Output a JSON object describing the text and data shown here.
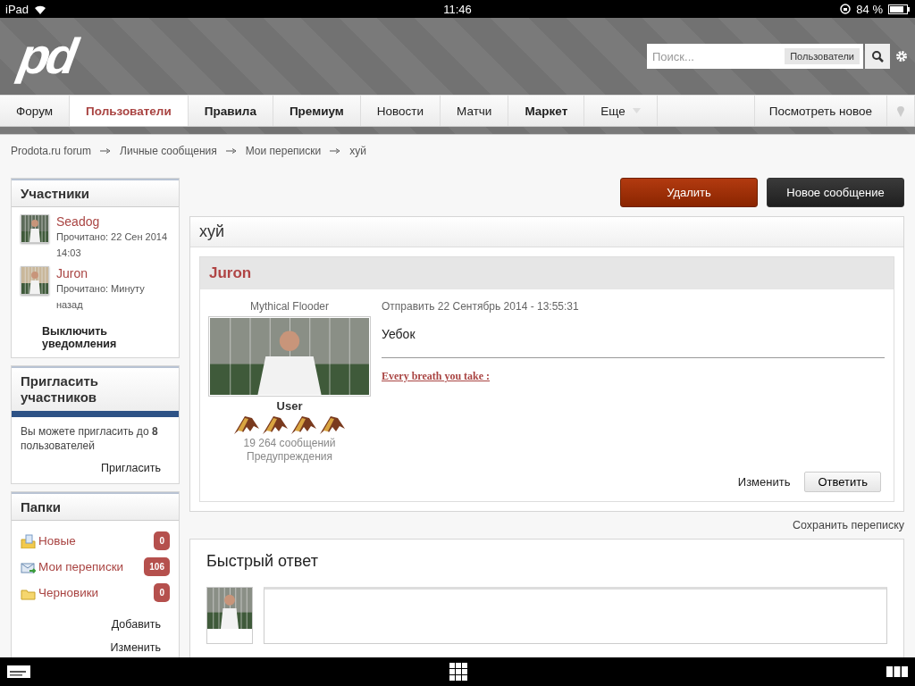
{
  "status_bar": {
    "device": "iPad",
    "time": "11:46",
    "battery": "84 %"
  },
  "header": {
    "logo": "pd",
    "search": {
      "placeholder": "Поиск...",
      "scope": "Пользователи"
    }
  },
  "nav": {
    "tabs": [
      {
        "label": "Форум",
        "selected": false,
        "kind": "plain"
      },
      {
        "label": "Пользователи",
        "selected": true,
        "kind": "plain"
      },
      {
        "label": "Правила",
        "selected": false,
        "kind": "strong"
      },
      {
        "label": "Премиум",
        "selected": false,
        "kind": "strong"
      },
      {
        "label": "Новости",
        "selected": false,
        "kind": "plain"
      },
      {
        "label": "Матчи",
        "selected": false,
        "kind": "plain"
      },
      {
        "label": "Маркет",
        "selected": false,
        "kind": "strong"
      },
      {
        "label": "Еще",
        "selected": false,
        "kind": "menu"
      }
    ],
    "right_link": "Посмотреть новое"
  },
  "breadcrumbs": [
    "Prodota.ru forum",
    "Личные сообщения",
    "Мои переписки",
    "хуй"
  ],
  "sidebar": {
    "participants": {
      "title": "Участники",
      "members": [
        {
          "name": "Seadog",
          "read": "Прочитано: 22 Сен 2014 14:03"
        },
        {
          "name": "Juron",
          "read": "Прочитано: Минуту назад"
        }
      ],
      "action": "Выключить уведомления"
    },
    "invite": {
      "title": "Пригласить участников",
      "text": "Вы можете пригласить до **8** пользователей",
      "action": "Пригласить"
    },
    "folders": {
      "title": "Папки",
      "items": [
        {
          "label": "Новые",
          "count": "0",
          "kind": "new"
        },
        {
          "label": "Мои переписки",
          "count": "106",
          "kind": "inbox"
        },
        {
          "label": "Черновики",
          "count": "0",
          "kind": "drafts"
        }
      ],
      "actions": [
        "Добавить",
        "Изменить"
      ]
    }
  },
  "actions": [
    {
      "label": "Удалить",
      "kind": "danger"
    },
    {
      "label": "Новое сообщение",
      "kind": "dark"
    }
  ],
  "conversation": {
    "title": "хуй",
    "message": {
      "author": "Juron",
      "user_title": "Mythical Flooder",
      "rank": "User",
      "posts": "19 264 сообщений",
      "warnings": "Предупреждения",
      "sent": "Отправить 22 Сентябрь 2014 - 13:55:31",
      "body": "Уебок",
      "signature": "Every breath you take :",
      "buttons": [
        {
          "label": "Изменить",
          "kind": "link"
        },
        {
          "label": "Ответить",
          "kind": "button"
        }
      ]
    }
  },
  "save_link": "Сохранить переписку",
  "quick_reply": {
    "title": "Быстрый ответ"
  }
}
